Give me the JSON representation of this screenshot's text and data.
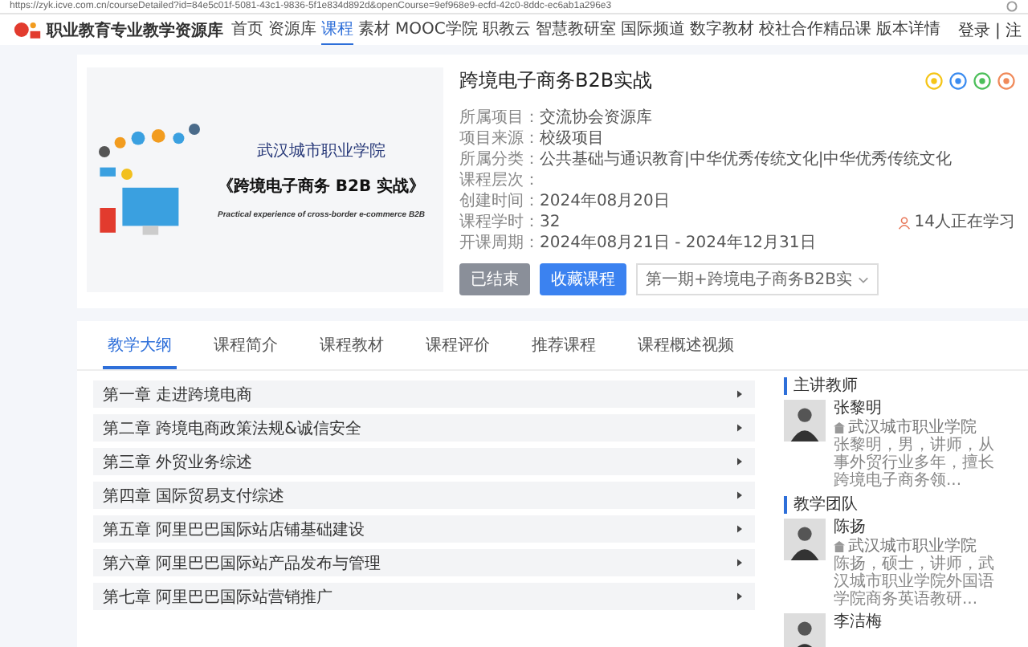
{
  "address_bar": {
    "url": "https://zyk.icve.com.cn/courseDetailed?id=84e5c01f-5081-43c1-9836-5f1e834d892d&openCourse=9ef968e9-ecfd-42c0-8ddc-ec6ab1a296e3"
  },
  "header": {
    "logo_text": "职业教育专业教学资源库",
    "nav": [
      {
        "label": "首页",
        "selected": false
      },
      {
        "label": "资源库",
        "selected": false
      },
      {
        "label": "课程",
        "selected": true
      },
      {
        "label": "素材",
        "selected": false
      },
      {
        "label": "MOOC学院",
        "selected": false
      },
      {
        "label": "职教云",
        "selected": false
      },
      {
        "label": "智慧教研室",
        "selected": false
      },
      {
        "label": "国际频道",
        "selected": false
      },
      {
        "label": "数字教材",
        "selected": false
      },
      {
        "label": "校社合作精品课",
        "selected": false
      },
      {
        "label": "版本详情",
        "selected": false
      }
    ],
    "login": "登录 | 注"
  },
  "course": {
    "cover": {
      "logo_text": "武汉城市职业学院",
      "title": "《跨境电子商务 B2B 实战》",
      "subtitle": "Practical experience of cross-border e-commerce B2B"
    },
    "title": "跨境电子商务B2B实战",
    "share_icons": [
      {
        "color": "#f5c518"
      },
      {
        "color": "#3b8cf0"
      },
      {
        "color": "#4cbf5a"
      },
      {
        "color": "#f08a5a"
      }
    ],
    "details": [
      {
        "label": "所属项目：",
        "value": "交流协会资源库"
      },
      {
        "label": "项目来源：",
        "value": "校级项目"
      },
      {
        "label": "所属分类：",
        "value": "公共基础与通识教育|中华优秀传统文化|中华优秀传统文化"
      },
      {
        "label": "课程层次："
      },
      {
        "label": "创建时间：",
        "value": "2024年08月20日"
      },
      {
        "label": "课程学时：",
        "value": "32"
      },
      {
        "label": "开课周期：",
        "value": "2024年08月21日 - 2024年12月31日"
      }
    ],
    "learners": "14人正在学习",
    "status_button": "已结束",
    "favorite_button": "收藏课程",
    "session_select": "第一期+跨境电子商务B2B实"
  },
  "tabs": [
    {
      "label": "教学大纲",
      "selected": true
    },
    {
      "label": "课程简介",
      "selected": false
    },
    {
      "label": "课程教材",
      "selected": false
    },
    {
      "label": "课程评价",
      "selected": false
    },
    {
      "label": "推荐课程",
      "selected": false
    },
    {
      "label": "课程概述视频",
      "selected": false
    }
  ],
  "chapters": [
    "第一章 走进跨境电商",
    "第二章 跨境电商政策法规&诚信安全",
    "第三章 外贸业务综述",
    "第四章 国际贸易支付综述",
    "第五章 阿里巴巴国际站店铺基础建设",
    "第六章 阿里巴巴国际站产品发布与管理",
    "第七章 阿里巴巴国际站营销推广"
  ],
  "sidebar": [
    {
      "heading": "主讲教师",
      "teachers": [
        {
          "name": "张黎明",
          "school": "武汉城市职业学院",
          "bio": "张黎明，男，讲师，从事外贸行业多年，擅长跨境电子商务领..."
        }
      ]
    },
    {
      "heading": "教学团队",
      "teachers": [
        {
          "name": "陈扬",
          "school": "武汉城市职业学院",
          "bio": "陈扬，硕士，讲师，武汉城市职业学院外国语学院商务英语教研..."
        },
        {
          "name": "李洁梅"
        }
      ]
    }
  ]
}
